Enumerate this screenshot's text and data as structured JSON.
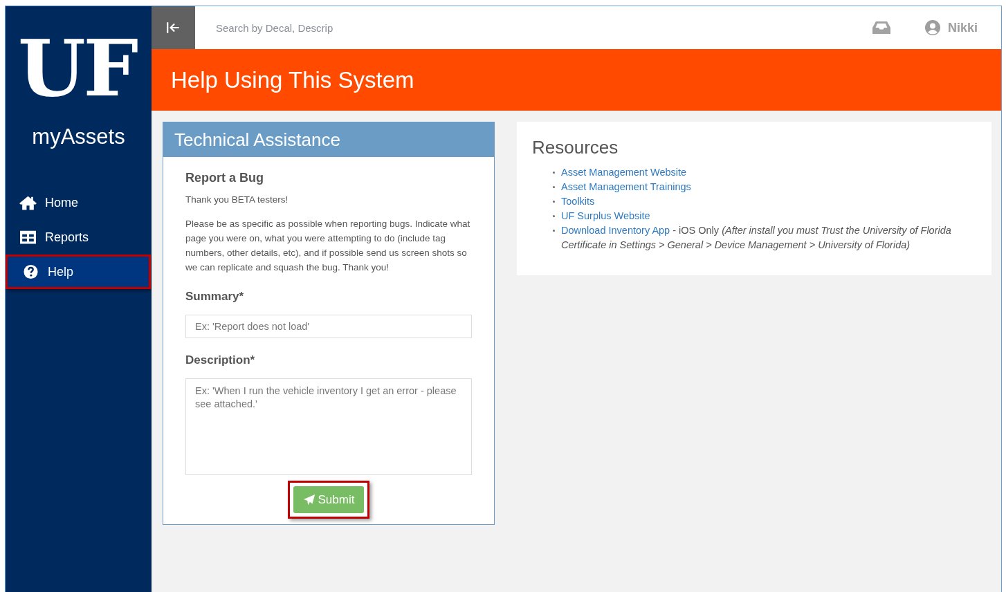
{
  "sidebar": {
    "logo": "UF",
    "app_name": "myAssets",
    "items": [
      {
        "label": "Home",
        "selected": false,
        "highlighted": false
      },
      {
        "label": "Reports",
        "selected": false,
        "highlighted": false
      },
      {
        "label": "Help",
        "selected": true,
        "highlighted": true
      }
    ]
  },
  "topbar": {
    "search": {
      "placeholder": "Search by Decal, Descrip"
    },
    "user": "Nikki"
  },
  "page_title": "Help Using This System",
  "assistance": {
    "title": "Technical Assistance",
    "heading": "Report a Bug",
    "thanks": "Thank you BETA testers!",
    "instructions": "Please be as specific as possible when reporting bugs. Indicate what page you were on, what you were attempting to do (include tag numbers, other details, etc), and if possible send us screen shots so we can replicate and squash the bug. Thank you!",
    "summary": {
      "label": "Summary*",
      "placeholder": "Ex: 'Report does not load'"
    },
    "description": {
      "label": "Description*",
      "placeholder": "Ex: 'When I run the vehicle inventory I get an error - please see attached.'"
    },
    "submit": {
      "label": "Submit",
      "highlighted": true
    }
  },
  "resources": {
    "title": "Resources",
    "items": [
      {
        "link": "Asset Management Website"
      },
      {
        "link": "Asset Management Trainings"
      },
      {
        "link": "Toolkits"
      },
      {
        "link": "UF Surplus Website"
      },
      {
        "link": "Download Inventory App",
        "note": "- iOS Only *(After install you must Trust the University of Florida Certificate in Settings > General > Device Management > University of Florida)*"
      }
    ]
  }
}
